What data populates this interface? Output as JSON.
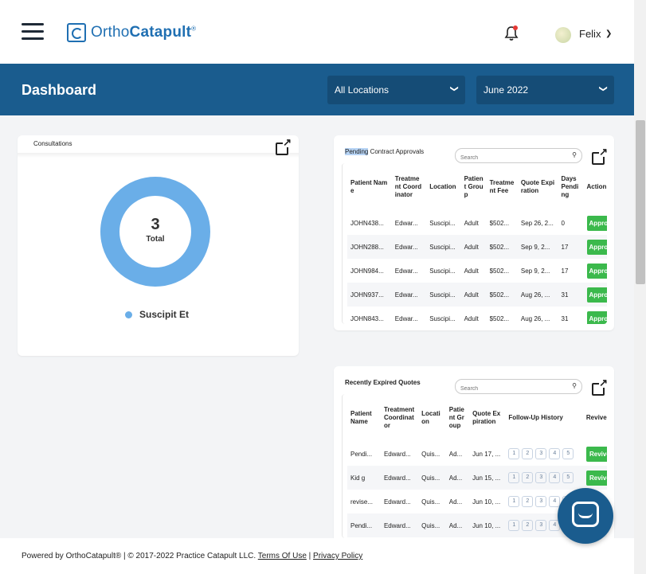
{
  "header": {
    "logo_text_a": "Ortho",
    "logo_text_b": "Catapult",
    "logo_mark": "®",
    "user_name": "Felix"
  },
  "dashboard": {
    "title": "Dashboard",
    "location_select": "All Locations",
    "month_select": "June 2022"
  },
  "consultations": {
    "title": "Consultations",
    "total_value": "3",
    "total_label": "Total",
    "legend": "Suscipit Et",
    "legend_color": "#6aaee8"
  },
  "pending": {
    "title_highlight": "Pending",
    "title_rest": " Contract Approvals",
    "search_placeholder": "Search",
    "headers": [
      "Patient Name",
      "Treatment Coordinator",
      "Location",
      "Patient Group",
      "Treatment Fee",
      "Quote Expiration",
      "Days Pending",
      "Action"
    ],
    "rows": [
      [
        "JOHN438...",
        "Edwar...",
        "Suscipi...",
        "Adult",
        "$502...",
        "Sep 26, 2...",
        "0",
        "Approve"
      ],
      [
        "JOHN288...",
        "Edwar...",
        "Suscipi...",
        "Adult",
        "$502...",
        "Sep 9, 2...",
        "17",
        "Approve"
      ],
      [
        "JOHN984...",
        "Edwar...",
        "Suscipi...",
        "Adult",
        "$502...",
        "Sep 9, 2...",
        "17",
        "Approve"
      ],
      [
        "JOHN937...",
        "Edwar...",
        "Suscipi...",
        "Adult",
        "$502...",
        "Aug 26, ...",
        "31",
        "Approve"
      ],
      [
        "JOHN843...",
        "Edwar...",
        "Suscipi...",
        "Adult",
        "$502...",
        "Aug 26, ...",
        "31",
        "Approve"
      ]
    ]
  },
  "expired": {
    "title": "Recently Expired Quotes",
    "search_placeholder": "Search",
    "headers": [
      "Patient Name",
      "Treatment Coordinator",
      "Location",
      "Patient Group",
      "Quote Expiration",
      "Follow-Up History",
      "Revive"
    ],
    "rows": [
      [
        "Pendi...",
        "Edward...",
        "Quis...",
        "Ad...",
        "Jun 17, ...",
        "Revive"
      ],
      [
        "Kid g",
        "Edward...",
        "Quis...",
        "Ad...",
        "Jun 15, ...",
        "Revive"
      ],
      [
        "revise...",
        "Edward...",
        "Quis...",
        "Ad...",
        "Jun 10, ...",
        ""
      ],
      [
        "Pendi...",
        "Edward...",
        "Quis...",
        "Ad...",
        "Jun 10, ...",
        ""
      ]
    ],
    "followups": [
      "1",
      "2",
      "3",
      "4",
      "5"
    ]
  },
  "footer": {
    "text": "Powered by OrthoCatapult® | © 2017-2022 Practice Catapult LLC. ",
    "terms": "Terms Of Use",
    "sep": " | ",
    "privacy": "Privacy Policy"
  }
}
